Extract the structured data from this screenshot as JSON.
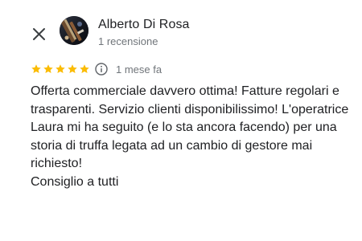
{
  "header": {
    "close_icon": "close-icon",
    "avatar_icon": "avatar-photo",
    "author_name": "Alberto Di Rosa",
    "author_meta": "1 recensione"
  },
  "review": {
    "rating": 5,
    "rating_max": 5,
    "star_color": "#fbbc04",
    "info_icon": "info-icon",
    "date": "1 mese fa",
    "text_paragraph": "Offerta commerciale davvero ottima! Fatture regolari e trasparenti. Servizio clienti disponibilissimo! L'operatrice Laura mi ha seguito (e lo sta ancora facendo) per una storia di truffa legata ad un cambio di gestore mai richiesto!",
    "text_closing": "Consiglio a tutti"
  }
}
